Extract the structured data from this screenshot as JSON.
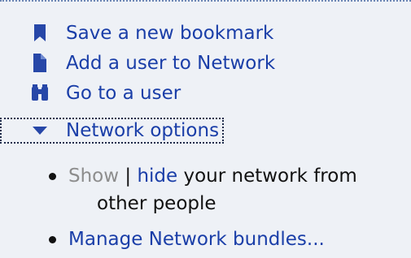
{
  "actions": [
    {
      "label": "Save a new bookmark",
      "icon": "bookmark-icon"
    },
    {
      "label": "Add a user to Network",
      "icon": "add-user-icon"
    },
    {
      "label": "Go to a user",
      "icon": "binoculars-icon"
    }
  ],
  "network_options": {
    "label": "Network options",
    "icon": "triangle-down-icon",
    "visibility": {
      "show": "Show",
      "separator": "|",
      "hide": "hide",
      "rest_line1": "your network from",
      "rest_line2": "other people"
    },
    "manage_bundles": "Manage Network bundles..."
  },
  "colors": {
    "link": "#1a3ea8",
    "icon": "#2747a8",
    "disabled": "#8d8d8d",
    "background": "#eef1f6"
  }
}
